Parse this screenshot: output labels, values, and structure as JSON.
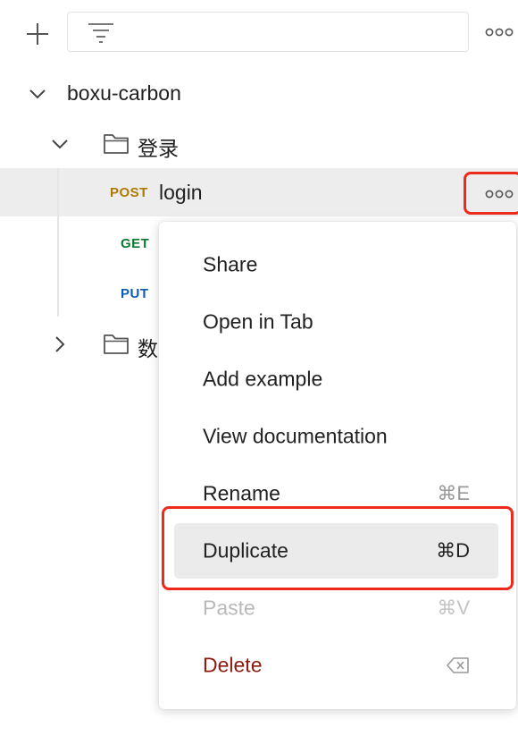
{
  "toolbar": {
    "add_icon": "plus-icon",
    "filter_icon": "filter-icon",
    "more_icon": "more-horizontal-icon"
  },
  "tree": {
    "collection": {
      "name": "boxu-carbon",
      "expanded": true
    },
    "folders": [
      {
        "name": "登录",
        "expanded": true,
        "requests": [
          {
            "method": "POST",
            "name": "login",
            "selected": true
          },
          {
            "method": "GET",
            "name": ""
          },
          {
            "method": "PUT",
            "name": ""
          }
        ]
      },
      {
        "name": "数",
        "expanded": false
      }
    ]
  },
  "context_menu": {
    "items": [
      {
        "label": "Share",
        "shortcut": ""
      },
      {
        "label": "Open in Tab",
        "shortcut": ""
      },
      {
        "label": "Add example",
        "shortcut": ""
      },
      {
        "label": "View documentation",
        "shortcut": ""
      },
      {
        "label": "Rename",
        "shortcut": "⌘E"
      },
      {
        "label": "Duplicate",
        "shortcut": "⌘D",
        "state": "hovered"
      },
      {
        "label": "Paste",
        "shortcut": "⌘V",
        "state": "disabled"
      },
      {
        "label": "Delete",
        "shortcut_icon": "backspace-icon",
        "state": "danger"
      }
    ]
  },
  "colors": {
    "post": "#ad7a03",
    "get": "#0b7a30",
    "put": "#0a5cb8",
    "highlight": "#ee2a1c",
    "delete": "#8e1a10"
  }
}
